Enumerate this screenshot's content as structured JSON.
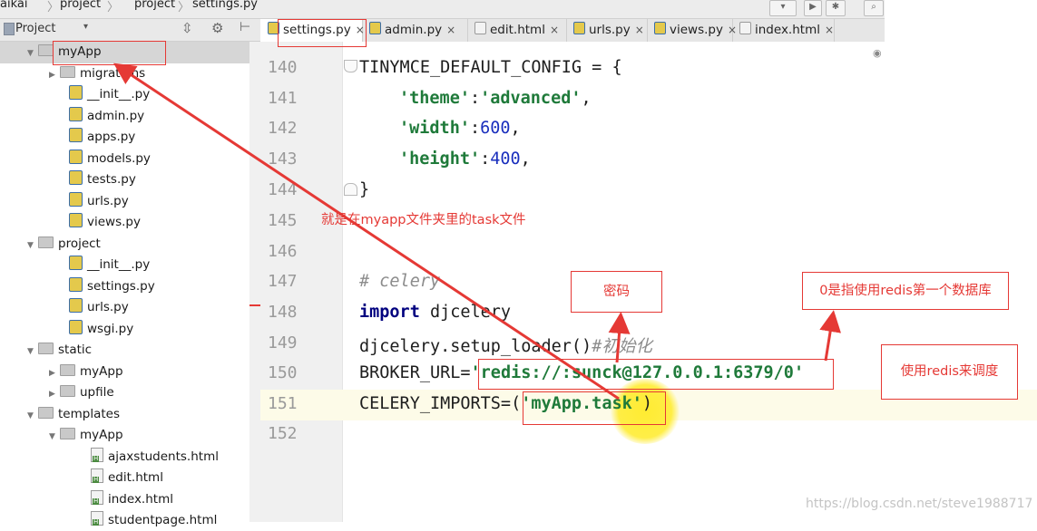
{
  "breadcrumb": [
    "aikai",
    "project",
    "project",
    "settings.py"
  ],
  "project_panel": {
    "title": "Project"
  },
  "tree": [
    {
      "label": "myApp",
      "type": "folder",
      "indent": 1,
      "expanded": true,
      "selected": true
    },
    {
      "label": "migrations",
      "type": "folder",
      "indent": 2,
      "expanded": false
    },
    {
      "label": "__init__.py",
      "type": "py",
      "indent": 3
    },
    {
      "label": "admin.py",
      "type": "py",
      "indent": 3
    },
    {
      "label": "apps.py",
      "type": "py",
      "indent": 3
    },
    {
      "label": "models.py",
      "type": "py",
      "indent": 3
    },
    {
      "label": "tests.py",
      "type": "py",
      "indent": 3
    },
    {
      "label": "urls.py",
      "type": "py",
      "indent": 3
    },
    {
      "label": "views.py",
      "type": "py",
      "indent": 3
    },
    {
      "label": "project",
      "type": "folder",
      "indent": 1,
      "expanded": true
    },
    {
      "label": "__init__.py",
      "type": "py",
      "indent": 3
    },
    {
      "label": "settings.py",
      "type": "py",
      "indent": 3
    },
    {
      "label": "urls.py",
      "type": "py",
      "indent": 3
    },
    {
      "label": "wsgi.py",
      "type": "py",
      "indent": 3
    },
    {
      "label": "static",
      "type": "folder",
      "indent": 1,
      "expanded": true
    },
    {
      "label": "myApp",
      "type": "folder",
      "indent": 2,
      "expanded": false
    },
    {
      "label": "upfile",
      "type": "folder",
      "indent": 2,
      "expanded": false
    },
    {
      "label": "templates",
      "type": "folder",
      "indent": 1,
      "expanded": true
    },
    {
      "label": "myApp",
      "type": "folder",
      "indent": 2,
      "expanded": true
    },
    {
      "label": "ajaxstudents.html",
      "type": "html",
      "indent": 4
    },
    {
      "label": "edit.html",
      "type": "html",
      "indent": 4
    },
    {
      "label": "index.html",
      "type": "html",
      "indent": 4
    },
    {
      "label": "studentpage.html",
      "type": "html",
      "indent": 4
    }
  ],
  "tabs": [
    {
      "label": "settings.py",
      "icon": "python-file-icon",
      "active": true
    },
    {
      "label": "admin.py",
      "icon": "python-file-icon",
      "active": false
    },
    {
      "label": "edit.html",
      "icon": "html-file-icon",
      "active": false
    },
    {
      "label": "urls.py",
      "icon": "python-file-icon",
      "active": false
    },
    {
      "label": "views.py",
      "icon": "python-file-icon",
      "active": false
    },
    {
      "label": "index.html",
      "icon": "html-file-icon",
      "active": false
    }
  ],
  "editor": {
    "line_numbers": [
      "140",
      "141",
      "142",
      "143",
      "144",
      "145",
      "146",
      "147",
      "148",
      "149",
      "150",
      "151",
      "152"
    ],
    "current_line": "151",
    "code": {
      "l140": "TINYMCE_DEFAULT_CONFIG = {",
      "l141_key": "'theme'",
      "l141_sep": ":",
      "l141_val": "'advanced'",
      "l141_end": ",",
      "l142_key": "'width'",
      "l142_val": "600",
      "l142_end": ",",
      "l143_key": "'height'",
      "l143_val": "400",
      "l143_end": ",",
      "l144": "}",
      "l147": "# celery",
      "l148_kw": "import",
      "l148_rest": " djcelery",
      "l149": "djcelery.setup_loader()",
      "l149_cmt": "#初始化",
      "l150_name": "BROKER_URL=",
      "l150_val": "'redis://:sunck@127.0.0.1:6379/0'",
      "l151_name": "CELERY_IMPORTS=(",
      "l151_val": "'myApp.task'",
      "l151_end": ")"
    }
  },
  "annotations": {
    "task_folder": "就是在myapp文件夹里的task文件",
    "password": "密码",
    "db_index": "0是指使用redis第一个数据库",
    "redis_schedule": "使用redis来调度"
  },
  "watermark": "https://blog.csdn.net/steve1988717",
  "colors": {
    "annotation": "#e53935",
    "string": "#1f7a3a",
    "number": "#1a2fbd",
    "keyword": "#00007f"
  }
}
